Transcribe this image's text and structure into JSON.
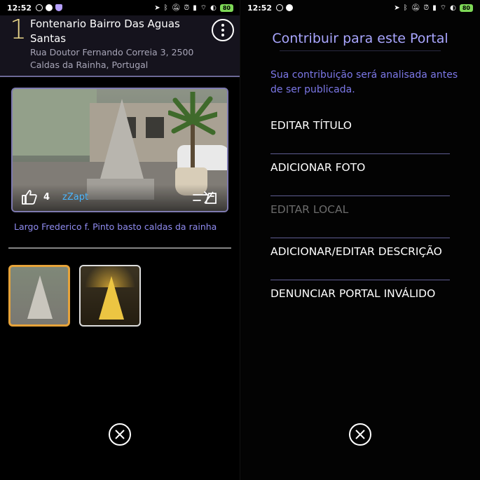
{
  "left": {
    "status": {
      "time": "12:52",
      "battery": "80"
    },
    "portal": {
      "level": "1",
      "title": "Fontenario Bairro Das Aguas Santas",
      "address": "Rua Doutor Fernando Correia 3, 2500 Caldas da Rainha, Portugal"
    },
    "photo": {
      "likes": "4",
      "author": "zZapt",
      "caption": "Largo Frederico f. Pinto basto caldas da rainha"
    }
  },
  "right": {
    "status": {
      "time": "12:52",
      "battery": "80"
    },
    "title": "Contribuir para este Portal",
    "subtitle": "Sua contribuição será analisada antes de ser publicada.",
    "menu": [
      {
        "label": "EDITAR TÍTULO",
        "enabled": true
      },
      {
        "label": "ADICIONAR FOTO",
        "enabled": true
      },
      {
        "label": "EDITAR LOCAL",
        "enabled": false
      },
      {
        "label": "ADICIONAR/EDITAR DESCRIÇÃO",
        "enabled": true
      },
      {
        "label": "DENUNCIAR PORTAL INVÁLIDO",
        "enabled": true
      }
    ]
  },
  "colors": {
    "accent": "#a9a6ff",
    "level": "#e8d58a",
    "author": "#49b6ff",
    "selected_thumb": "#e6a33a"
  }
}
